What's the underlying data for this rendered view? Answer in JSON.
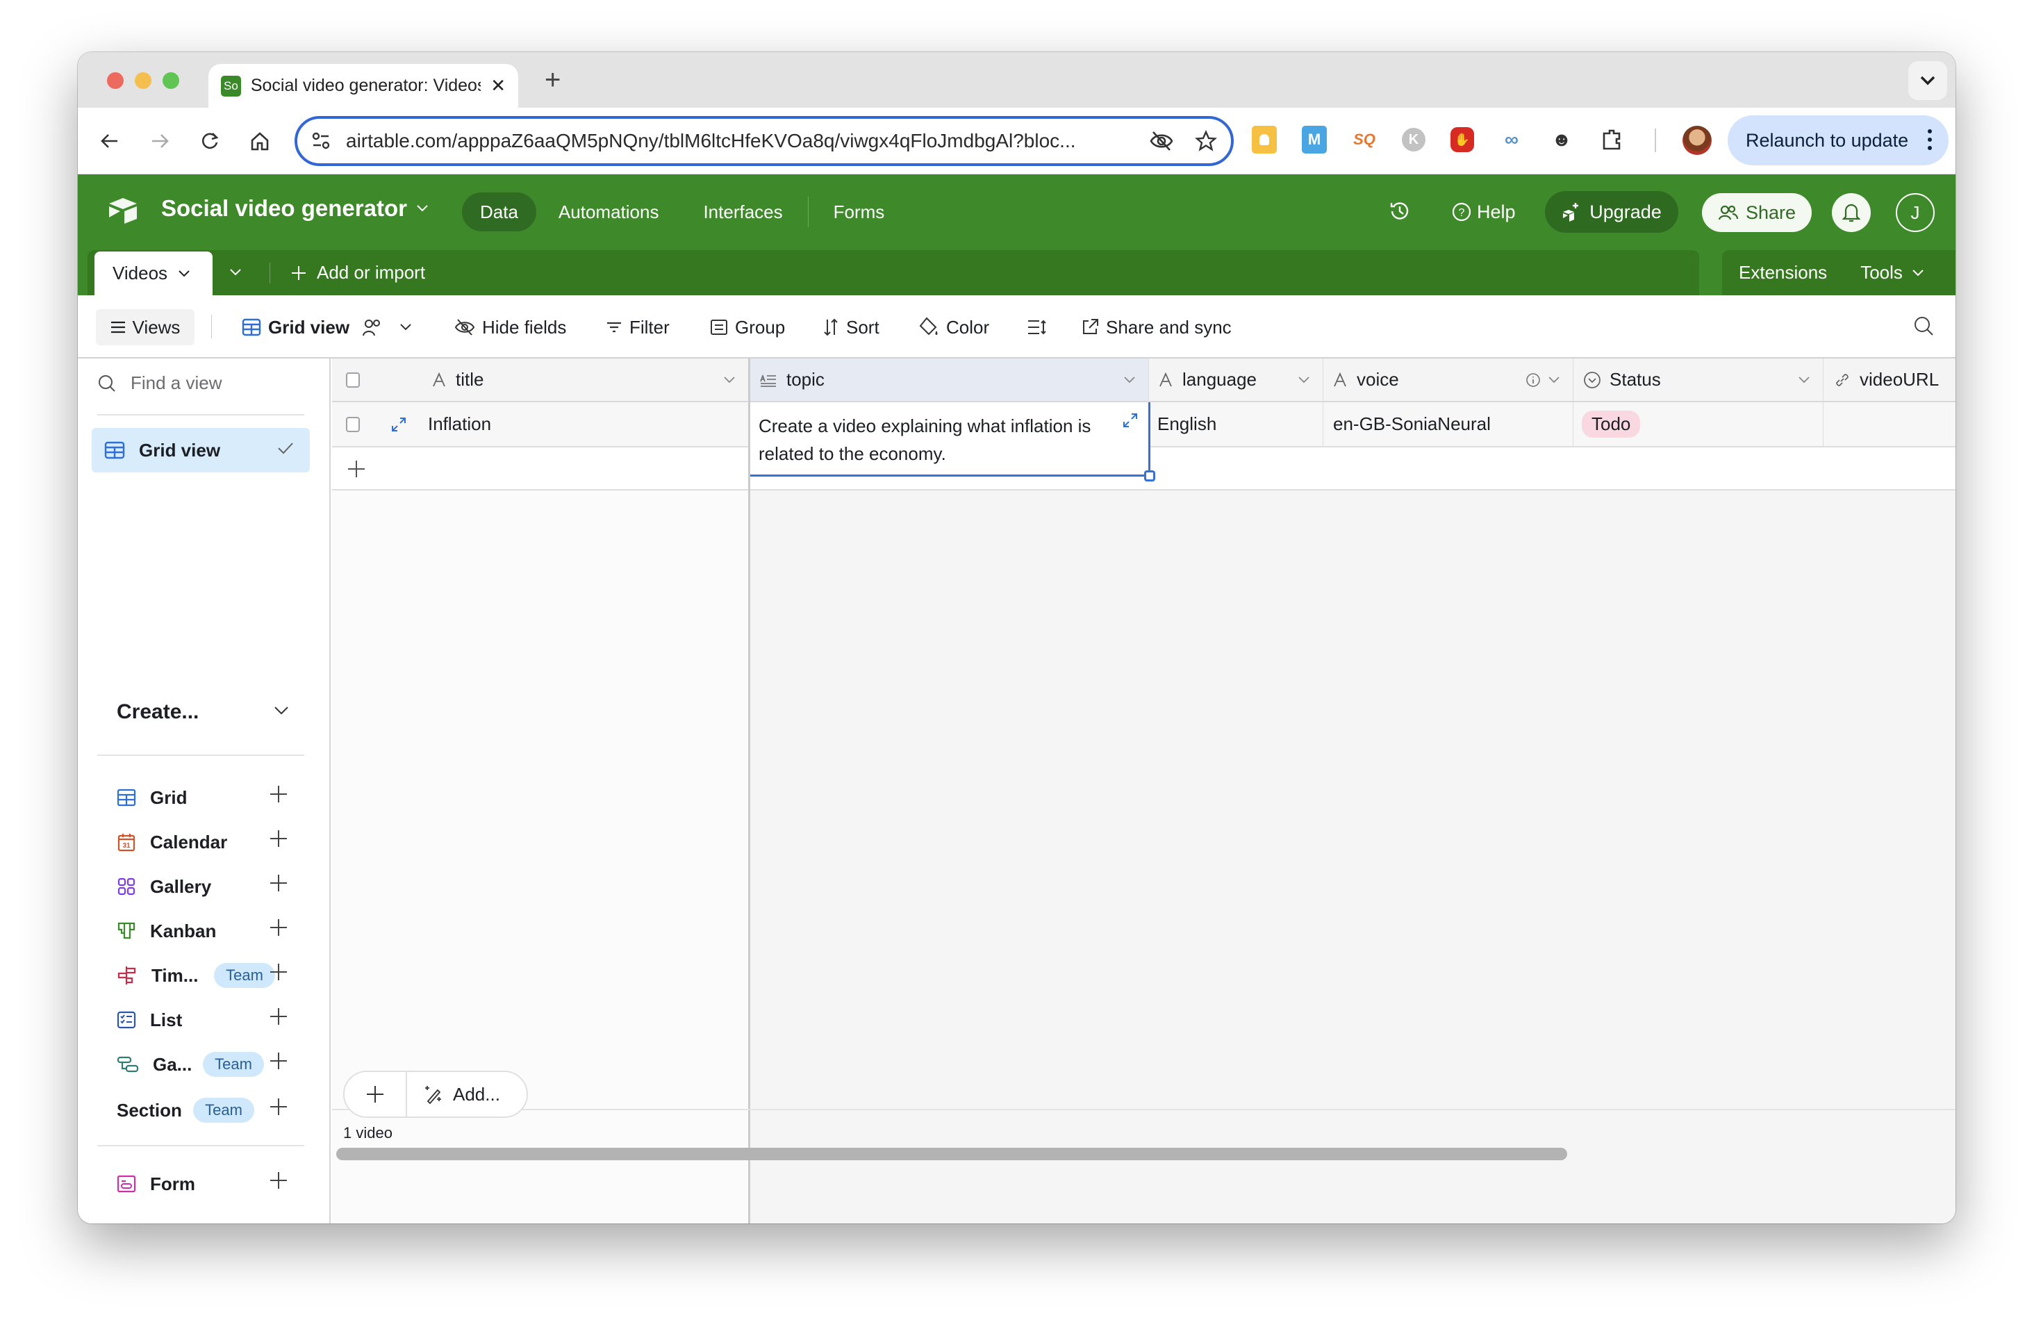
{
  "browser": {
    "tab_title": "Social video generator: Videos",
    "favicon_text": "So",
    "url": "airtable.com/apppaZ6aaQM5pNQny/tblM6ltcHfeKVOa8q/viwgx4qFloJmdbgAl?bloc...",
    "relaunch_label": "Relaunch to update",
    "extensions": [
      "notes-extension-icon",
      "m-extension-icon",
      "sq-extension-icon",
      "k-extension-icon",
      "adblock-extension-icon",
      "link-extension-icon",
      "spider-extension-icon",
      "puzzle-extensions-icon"
    ]
  },
  "app": {
    "base_name": "Social video generator",
    "nav": [
      "Data",
      "Automations",
      "Interfaces",
      "Forms"
    ],
    "active_nav": "Data",
    "help_label": "Help",
    "upgrade_label": "Upgrade",
    "share_label": "Share",
    "avatar_initial": "J",
    "brand_color": "#3e892a"
  },
  "tablebar": {
    "active_table": "Videos",
    "add_import_label": "Add or import",
    "extensions_label": "Extensions",
    "tools_label": "Tools"
  },
  "toolbar": {
    "views_label": "Views",
    "current_view": "Grid view",
    "hide_fields": "Hide fields",
    "filter": "Filter",
    "group": "Group",
    "sort": "Sort",
    "color": "Color",
    "share_sync": "Share and sync"
  },
  "sidebar": {
    "find_placeholder": "Find a view",
    "views": [
      {
        "label": "Grid view",
        "selected": true
      }
    ],
    "create_heading": "Create...",
    "create_items": [
      {
        "label": "Grid",
        "icon": "grid-icon",
        "color": "#2d6fd6",
        "badge": null
      },
      {
        "label": "Calendar",
        "icon": "calendar-icon",
        "color": "#d0532a",
        "badge": null
      },
      {
        "label": "Gallery",
        "icon": "gallery-icon",
        "color": "#7c3aed",
        "badge": null
      },
      {
        "label": "Kanban",
        "icon": "kanban-icon",
        "color": "#3b8a2a",
        "badge": null
      },
      {
        "label": "Tim...",
        "icon": "timeline-icon",
        "color": "#c62d4a",
        "badge": "Team"
      },
      {
        "label": "List",
        "icon": "list-icon",
        "color": "#2a56a8",
        "badge": null
      },
      {
        "label": "Ga...",
        "icon": "gantt-icon",
        "color": "#2f7c73",
        "badge": "Team"
      },
      {
        "label": "Section",
        "icon": null,
        "color": null,
        "badge": "Team"
      },
      {
        "label": "Form",
        "icon": "form-icon",
        "color": "#cc2fa8",
        "badge": null
      }
    ],
    "calendar_day": "31"
  },
  "grid": {
    "columns": [
      {
        "name": "title",
        "type_icon": "text-field-icon"
      },
      {
        "name": "topic",
        "type_icon": "long-text-field-icon"
      },
      {
        "name": "language",
        "type_icon": "text-field-icon"
      },
      {
        "name": "voice",
        "type_icon": "text-field-icon"
      },
      {
        "name": "Status",
        "type_icon": "single-select-field-icon"
      },
      {
        "name": "videoURL",
        "type_icon": "url-field-icon"
      }
    ],
    "rows": [
      {
        "title": "Inflation",
        "topic": "Create a video explaining what inflation is related to the economy.",
        "language": "English",
        "voice": "en-GB-SoniaNeural",
        "Status": "Todo",
        "videoURL": ""
      }
    ],
    "status_colors": {
      "Todo": "#f9d8e1"
    },
    "add_label": "Add...",
    "record_count": "1 video"
  }
}
